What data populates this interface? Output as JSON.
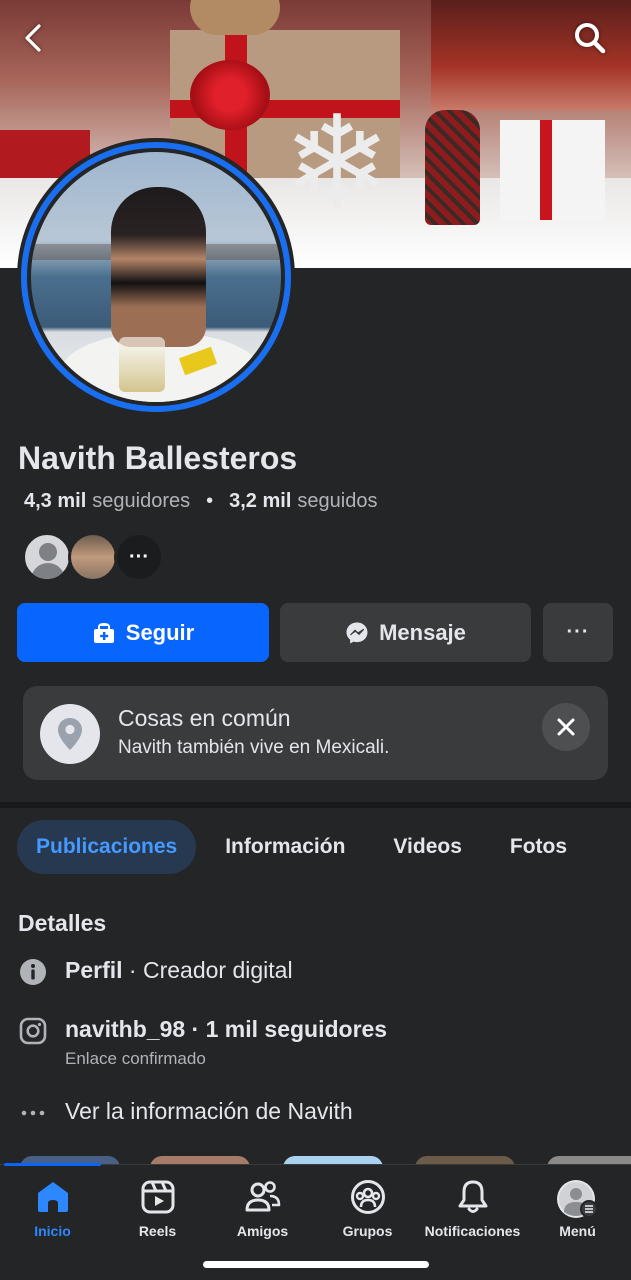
{
  "profile": {
    "name": "Navith Ballesteros",
    "followers_count": "4,3 mil",
    "followers_label": "seguidores",
    "following_count": "3,2 mil",
    "following_label": "seguidos",
    "separator": "•",
    "mutuals_more": "···"
  },
  "actions": {
    "follow_label": "Seguir",
    "message_label": "Mensaje",
    "more_label": "···"
  },
  "common": {
    "title": "Cosas en común",
    "subtitle": "Navith también vive en Mexicali."
  },
  "tabs": [
    {
      "label": "Publicaciones",
      "active": true
    },
    {
      "label": "Información",
      "active": false
    },
    {
      "label": "Videos",
      "active": false
    },
    {
      "label": "Fotos",
      "active": false
    }
  ],
  "details": {
    "title": "Detalles",
    "profile_label": "Perfil",
    "profile_value": "· Creador digital",
    "instagram_handle": "navithb_98",
    "instagram_followers": "· 1 mil seguidores",
    "instagram_note": "Enlace confirmado",
    "more_info": "Ver la información de Navith"
  },
  "bottom_nav": [
    {
      "label": "Inicio",
      "icon": "home-icon",
      "active": true
    },
    {
      "label": "Reels",
      "icon": "reels-icon",
      "active": false
    },
    {
      "label": "Amigos",
      "icon": "friends-icon",
      "active": false
    },
    {
      "label": "Grupos",
      "icon": "groups-icon",
      "active": false
    },
    {
      "label": "Notificaciones",
      "icon": "bell-icon",
      "active": false
    },
    {
      "label": "Menú",
      "icon": "menu-avatar-icon",
      "active": false
    }
  ],
  "colors": {
    "background": "#242526",
    "accent": "#0866ff",
    "secondary_button": "#3a3b3c",
    "active_tab_bg": "#263951",
    "active_tab_text": "#4599ff"
  }
}
